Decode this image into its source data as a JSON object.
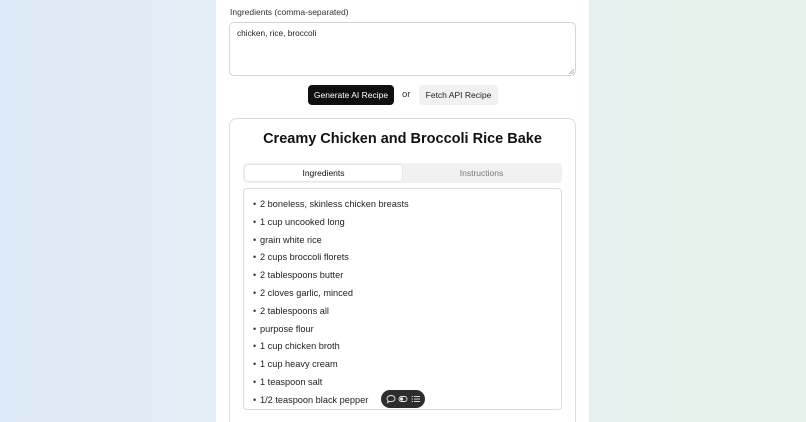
{
  "form": {
    "ingredients_label": "Ingredients (comma-separated)",
    "ingredients_value": "chicken, rice, broccoli",
    "generate_ai_label": "Generate AI Recipe",
    "or_text": "or",
    "fetch_api_label": "Fetch API Recipe"
  },
  "recipe": {
    "title": "Creamy Chicken and Broccoli Rice Bake",
    "tabs": [
      {
        "label": "Ingredients",
        "active": true
      },
      {
        "label": "Instructions",
        "active": false
      }
    ],
    "ingredients": [
      "2 boneless, skinless chicken breasts",
      "1 cup uncooked long",
      "grain white rice",
      "2 cups broccoli florets",
      "2 tablespoons butter",
      "2 cloves garlic, minced",
      "2 tablespoons all",
      "purpose flour",
      "1 cup chicken broth",
      "1 cup heavy cream",
      "1 teaspoon salt",
      "1/2 teaspoon black pepper"
    ]
  },
  "toolbar": {
    "icons": [
      "chat-bubble-icon",
      "toggle-icon",
      "list-icon"
    ]
  },
  "colors": {
    "primary_button": "#0f0f0f",
    "secondary_button": "#f1f1f1",
    "toolbar_bg": "#2d2d2d"
  }
}
